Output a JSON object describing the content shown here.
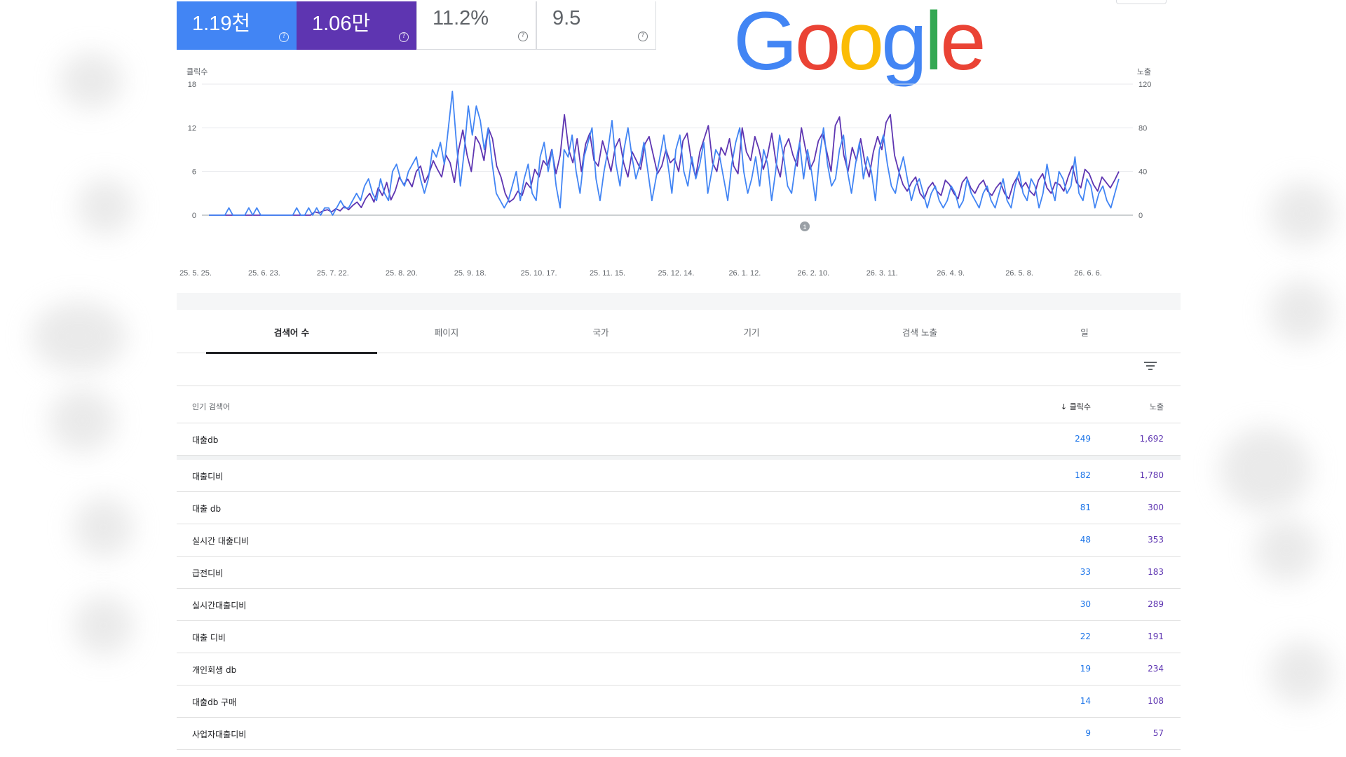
{
  "metrics": [
    {
      "value": "1.19천",
      "help": "?"
    },
    {
      "value": "1.06만",
      "help": "?"
    },
    {
      "value": "11.2%",
      "help": "?"
    },
    {
      "value": "9.5",
      "help": "?"
    }
  ],
  "logo_text": [
    "G",
    "o",
    "o",
    "g",
    "l",
    "e"
  ],
  "colors": {
    "clicks": "#4285f4",
    "impressions": "#5e35b1",
    "logo": [
      "#4285f4",
      "#ea4335",
      "#fbbc05",
      "#4285f4",
      "#34a853",
      "#ea4335"
    ]
  },
  "chart_data": {
    "type": "line",
    "ylabel_left": "클릭수",
    "ylabel_right": "노출",
    "left_ticks": [
      "18",
      "12",
      "6",
      "0"
    ],
    "right_ticks": [
      "120",
      "80",
      "40",
      "0"
    ],
    "ylim_left": [
      0,
      18
    ],
    "ylim_right": [
      0,
      120
    ],
    "x_ticks": [
      "25. 5. 25.",
      "25. 6. 23.",
      "25. 7. 22.",
      "25. 8. 20.",
      "25. 9. 18.",
      "25. 10. 17.",
      "25. 11. 15.",
      "25. 12. 14.",
      "26. 1. 12.",
      "26. 2. 10.",
      "26. 3. 11.",
      "26. 4. 9.",
      "26. 5. 8.",
      "26. 6. 6."
    ],
    "annotation": "1",
    "grid": true,
    "series": [
      {
        "name": "클릭수",
        "axis": "left",
        "values": [
          0,
          0,
          0,
          0,
          0,
          1,
          0,
          0,
          0,
          0,
          1,
          0,
          1,
          0,
          0,
          0,
          0,
          0,
          0,
          0,
          0,
          0,
          1,
          0,
          0,
          1,
          0,
          1,
          0,
          1,
          1,
          0,
          1,
          2,
          1,
          1,
          2,
          3,
          2,
          4,
          5,
          3,
          2,
          5,
          3,
          2,
          6,
          7,
          5,
          4,
          6,
          7,
          8,
          5,
          3,
          5,
          9,
          8,
          10,
          7,
          12,
          17,
          10,
          4,
          9,
          15,
          11,
          15,
          13,
          9,
          12,
          7,
          3,
          2,
          1,
          2,
          4,
          6,
          2,
          5,
          7,
          3,
          2,
          8,
          10,
          6,
          9,
          4,
          1,
          9,
          8,
          11,
          6,
          3,
          8,
          10,
          12,
          5,
          2,
          6,
          9,
          13,
          7,
          4,
          9,
          12,
          8,
          5,
          7,
          10,
          6,
          2,
          5,
          8,
          11,
          7,
          3,
          9,
          11,
          6,
          4,
          8,
          5,
          7,
          10,
          3,
          6,
          9,
          8,
          5,
          2,
          7,
          10,
          12,
          6,
          3,
          5,
          8,
          4,
          9,
          7,
          2,
          6,
          11,
          8,
          4,
          3,
          7,
          10,
          5,
          9,
          6,
          2,
          8,
          12,
          7,
          4,
          5,
          9,
          11,
          6,
          3,
          7,
          10,
          5,
          8,
          6,
          2,
          9,
          11,
          7,
          4,
          3,
          6,
          8,
          5,
          2,
          4,
          5,
          3,
          1,
          3,
          4,
          2,
          1,
          2,
          4,
          3,
          1,
          2,
          5,
          3,
          2,
          1,
          3,
          4,
          2,
          1,
          3,
          5,
          2,
          1,
          4,
          6,
          3,
          2,
          5,
          4,
          1,
          3,
          7,
          4,
          2,
          6,
          5,
          3,
          4,
          8,
          3,
          2,
          5,
          4,
          1,
          3,
          4,
          2,
          1,
          3,
          5
        ]
      },
      {
        "name": "노출",
        "axis": "right",
        "values": [
          0,
          0,
          0,
          0,
          0,
          0,
          0,
          0,
          0,
          0,
          0,
          0,
          0,
          0,
          0,
          0,
          0,
          0,
          0,
          0,
          0,
          0,
          0,
          0,
          0,
          3,
          2,
          4,
          5,
          3,
          6,
          4,
          8,
          5,
          9,
          12,
          7,
          15,
          20,
          12,
          25,
          18,
          30,
          14,
          22,
          35,
          28,
          33,
          26,
          40,
          45,
          30,
          38,
          50,
          42,
          35,
          55,
          48,
          30,
          60,
          78,
          55,
          40,
          72,
          65,
          50,
          80,
          70,
          45,
          35,
          20,
          12,
          15,
          22,
          18,
          30,
          25,
          42,
          35,
          50,
          45,
          60,
          38,
          55,
          92,
          60,
          48,
          70,
          40,
          65,
          75,
          50,
          45,
          68,
          55,
          40,
          62,
          70,
          48,
          35,
          58,
          50,
          42,
          65,
          72,
          55,
          38,
          45,
          60,
          48,
          52,
          40,
          68,
          75,
          50,
          35,
          58,
          70,
          82,
          48,
          40,
          62,
          55,
          70,
          45,
          38,
          80,
          58,
          50,
          72,
          60,
          42,
          55,
          75,
          48,
          35,
          62,
          70,
          55,
          45,
          80,
          60,
          42,
          50,
          68,
          75,
          58,
          40,
          82,
          90,
          55,
          40,
          62,
          50,
          70,
          48,
          35,
          58,
          72,
          60,
          85,
          92,
          55,
          40,
          28,
          22,
          30,
          35,
          20,
          15,
          25,
          30,
          22,
          18,
          32,
          28,
          20,
          15,
          30,
          35,
          25,
          20,
          28,
          32,
          22,
          18,
          25,
          30,
          20,
          15,
          28,
          35,
          25,
          30,
          22,
          18,
          32,
          38,
          25,
          20,
          30,
          28,
          22,
          35,
          45,
          30,
          25,
          42,
          38,
          28,
          22,
          35,
          30,
          25,
          32,
          40
        ]
      }
    ]
  },
  "tabs": [
    {
      "label": "검색어 수",
      "active": true
    },
    {
      "label": "페이지",
      "active": false
    },
    {
      "label": "국가",
      "active": false
    },
    {
      "label": "기기",
      "active": false
    },
    {
      "label": "검색 노출",
      "active": false
    },
    {
      "label": "일",
      "active": false
    }
  ],
  "table": {
    "headers": {
      "query": "인기 검색어",
      "clicks": "클릭수",
      "impressions": "노출"
    },
    "rows": [
      {
        "query": "대출db",
        "clicks": "249",
        "impressions": "1,692"
      },
      {
        "query": "대출디비",
        "clicks": "182",
        "impressions": "1,780"
      },
      {
        "query": "대출 db",
        "clicks": "81",
        "impressions": "300"
      },
      {
        "query": "실시간 대출디비",
        "clicks": "48",
        "impressions": "353"
      },
      {
        "query": "급전디비",
        "clicks": "33",
        "impressions": "183"
      },
      {
        "query": "실시간대출디비",
        "clicks": "30",
        "impressions": "289"
      },
      {
        "query": "대출 디비",
        "clicks": "22",
        "impressions": "191"
      },
      {
        "query": "개인회생 db",
        "clicks": "19",
        "impressions": "234"
      },
      {
        "query": "대출db 구매",
        "clicks": "14",
        "impressions": "108"
      },
      {
        "query": "사업자대출디비",
        "clicks": "9",
        "impressions": "57"
      }
    ]
  }
}
